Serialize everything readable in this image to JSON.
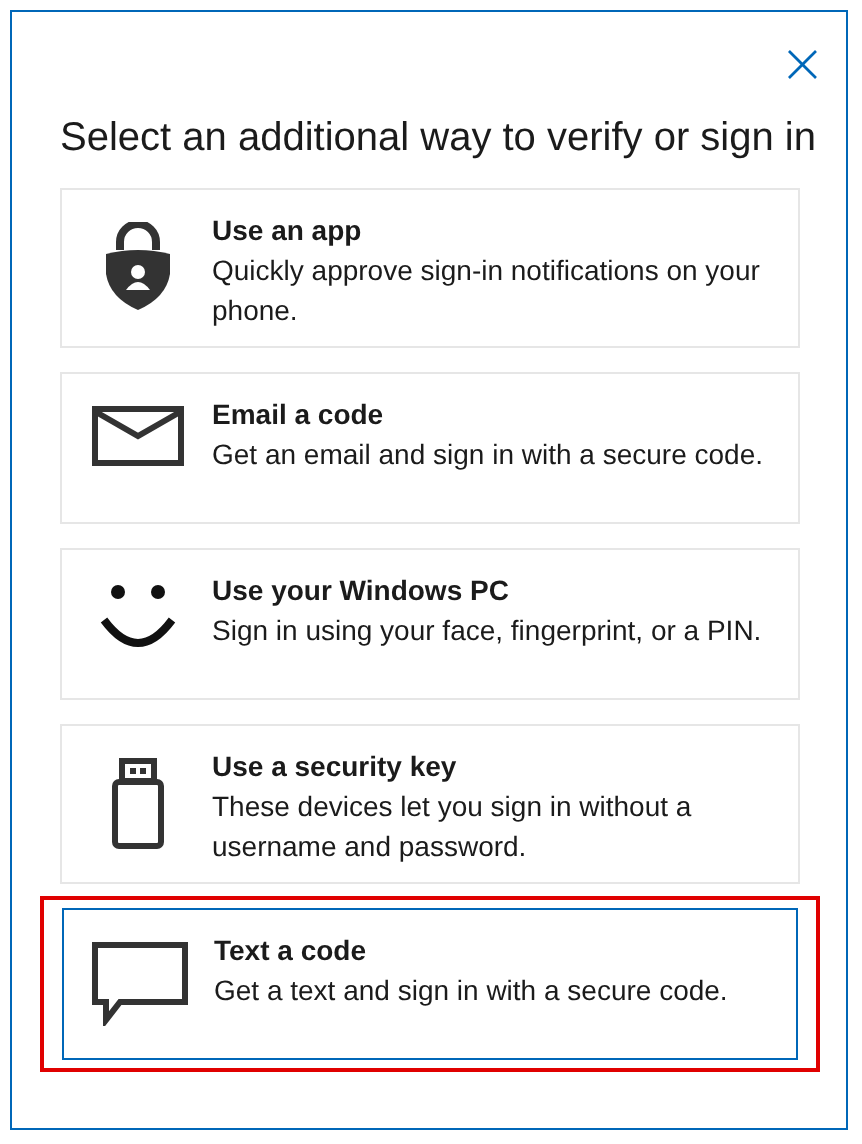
{
  "dialog": {
    "title": "Select an additional way to verify or sign in",
    "close_label": "×"
  },
  "methods": [
    {
      "kind": "app",
      "title": "Use an app",
      "description": "Quickly approve sign-in notifications on your phone.",
      "selected": false,
      "highlighted": false
    },
    {
      "kind": "email",
      "title": "Email a code",
      "description": "Get an email and sign in with a secure code.",
      "selected": false,
      "highlighted": false
    },
    {
      "kind": "face",
      "title": "Use your Windows PC",
      "description": "Sign in using your face, fingerprint, or a PIN.",
      "selected": false,
      "highlighted": false
    },
    {
      "kind": "key",
      "title": "Use a security key",
      "description": "These devices let you sign in without a username and password.",
      "selected": false,
      "highlighted": false
    },
    {
      "kind": "sms",
      "title": "Text a code",
      "description": "Get a text and sign in with a secure code.",
      "selected": true,
      "highlighted": true
    }
  ]
}
